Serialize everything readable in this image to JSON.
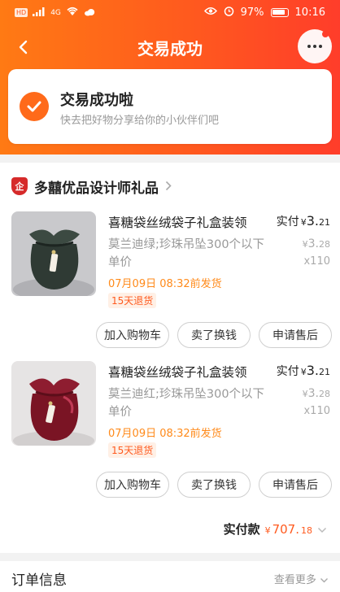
{
  "status_bar": {
    "left_chips": [
      "HD",
      "4G"
    ],
    "battery_percent": "97%",
    "time": "10:16"
  },
  "nav": {
    "title": "交易成功"
  },
  "success": {
    "title": "交易成功啦",
    "subtitle": "快去把好物分享给你的小伙伴们吧"
  },
  "store": {
    "logo_text": "企",
    "name": "多囍优品设计师礼品"
  },
  "items": [
    {
      "title": "喜糖袋丝绒袋子礼盒装领",
      "spec": "莫兰迪绿;珍珠吊坠300个以下单价",
      "ship": "07月09日 08:32前发货",
      "return_policy": "15天退货",
      "paid_label": "实付",
      "paid_currency": "¥",
      "paid_int": "3.",
      "paid_dec": "21",
      "orig_currency": "¥",
      "orig_int": "3.",
      "orig_dec": "28",
      "qty": "x110",
      "thumb_color": "#2f3a34",
      "buttons": [
        "加入购物车",
        "卖了换钱",
        "申请售后"
      ]
    },
    {
      "title": "喜糖袋丝绒袋子礼盒装领",
      "spec": "莫兰迪红;珍珠吊坠300个以下单价",
      "ship": "07月09日 08:32前发货",
      "return_policy": "15天退货",
      "paid_label": "实付",
      "paid_currency": "¥",
      "paid_int": "3.",
      "paid_dec": "21",
      "orig_currency": "¥",
      "orig_int": "3.",
      "orig_dec": "28",
      "qty": "x110",
      "thumb_color": "#7a1424",
      "buttons": [
        "加入购物车",
        "卖了换钱",
        "申请售后"
      ]
    }
  ],
  "total": {
    "label": "实付款",
    "currency": "¥",
    "int": "707.",
    "dec": "18"
  },
  "order_info": {
    "title": "订单信息",
    "more": "查看更多"
  },
  "colors": {
    "brand_orange": "#ff5a1e",
    "accent": "#ff6a1a",
    "ship_text": "#ff8a1a"
  }
}
